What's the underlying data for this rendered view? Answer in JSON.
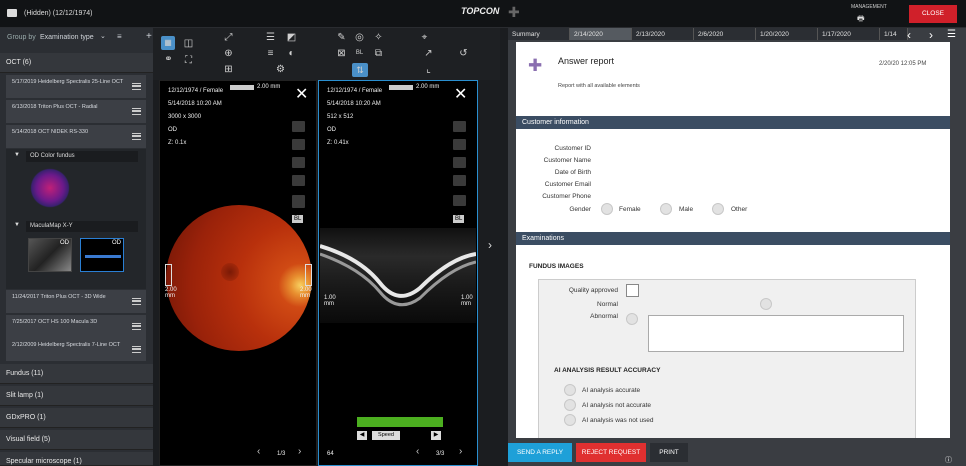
{
  "header": {
    "patient": "(Hidden) (12/12/1974)",
    "brand": "TOPCON",
    "management": "MANAGEMENT",
    "close": "CLOSE"
  },
  "left": {
    "group_by": "Group by",
    "group_value": "Examination type",
    "oct_section": "OCT (6)",
    "oct_items": [
      "5/17/2019 Heidelberg Spectralis 25-Line OCT",
      "6/13/2018 Triton Plus OCT - Radial",
      "5/14/2018 OCT NIDEK RS-330"
    ],
    "sub1": "OD Color fundus",
    "sub2": "MaculaMap X-Y",
    "thumb_label": "OD",
    "oct_items2": [
      "11/24/2017 Triton Plus OCT - 3D Wide",
      "7/25/2017 OCT HS 100 Macula 3D",
      "2/12/2009 Heidelberg Spectralis 7-Line OCT"
    ],
    "sections": [
      "Fundus (11)",
      "Slit lamp (1)",
      "GDxPRO (1)",
      "Visual field (5)",
      "Specular microscope (1)"
    ]
  },
  "viewer1": {
    "patient": "12/12/1974 / Female",
    "date": "5/14/2018 10:20 AM",
    "size": "3000 x 3000",
    "eye": "OD",
    "zoom": "Z: 0.1x",
    "scale": "2.00 mm",
    "side_scale": "2.00 mm",
    "page": "1/3"
  },
  "viewer2": {
    "patient": "12/12/1974 / Female",
    "date": "5/14/2018 10:20 AM",
    "size": "512 x 512",
    "eye": "OD",
    "zoom": "Z: 0.41x",
    "scale": "2.00 mm",
    "side_scale": "1.00 mm",
    "speed": "Speed",
    "frame": "64",
    "page": "3/3"
  },
  "tabs": [
    "Summary",
    "2/14/2020",
    "2/13/2020",
    "2/6/2020",
    "1/20/2020",
    "1/17/2020",
    "1/14"
  ],
  "report": {
    "title": "Answer report",
    "subtitle": "Report with all available elements",
    "date": "2/20/20 12:05 PM",
    "cust_header": "Customer information",
    "fields": [
      "Customer ID",
      "Customer Name",
      "Date of Birth",
      "Customer Email",
      "Customer Phone",
      "Gender"
    ],
    "gender_opts": [
      "Female",
      "Male",
      "Other"
    ],
    "exam_header": "Examinations",
    "fundus_title": "FUNDUS IMAGES",
    "quality": "Quality approved",
    "normal": "Normal",
    "abnormal": "Abnormal",
    "ai_title": "AI ANALYSIS RESULT ACCURACY",
    "ai_opts": [
      "AI analysis accurate",
      "AI analysis not accurate",
      "AI analysis was not used"
    ]
  },
  "buttons": {
    "reply": "SEND A REPLY",
    "reject": "REJECT REQUEST",
    "print": "PRINT"
  },
  "colors": {
    "accent": "#1ea0d8",
    "close": "#d0202a",
    "reject": "#e03030",
    "doc_header": "#3b4d63",
    "speed_bar": "#4caf20"
  }
}
